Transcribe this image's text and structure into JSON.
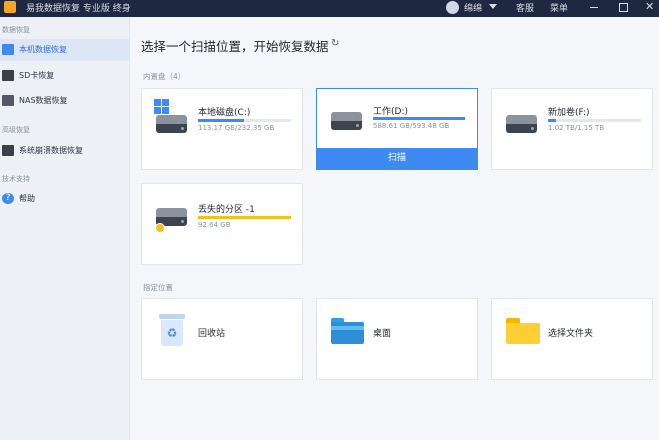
{
  "titlebar": {
    "app_title": "易我数据恢复 专业版 终身",
    "user_name": "绵绵",
    "service_label": "客服",
    "menu_label": "菜单",
    "close_glyph": "✕"
  },
  "sidebar": {
    "sections": [
      {
        "title": "数据恢复",
        "items": [
          {
            "label": "本机数据恢复",
            "icon": "monitor-icon",
            "active": true
          },
          {
            "label": "SD卡恢复",
            "icon": "sd-card-icon"
          },
          {
            "label": "NAS数据恢复",
            "icon": "nas-icon"
          }
        ]
      },
      {
        "title": "高级恢复",
        "items": [
          {
            "label": "系统崩溃数据恢复",
            "icon": "system-crash-icon"
          }
        ]
      },
      {
        "title": "技术支持",
        "items": [
          {
            "label": "帮助",
            "icon": "help-icon",
            "glyph": "?"
          }
        ]
      }
    ]
  },
  "main": {
    "title": "选择一个扫描位置，开始恢复数据",
    "refresh_glyph": "↻",
    "internal_disks": {
      "label": "内置盘（4）",
      "drives": [
        {
          "name": "本地磁盘(C:)",
          "size": "113.17 GB/232.35 GB",
          "used_fraction": 0.49,
          "icon": "windows-drive-icon"
        },
        {
          "name": "工作(D:)",
          "size": "588.61 GB/593.48 GB",
          "used_fraction": 0.99,
          "icon": "hard-drive-icon",
          "selected": true,
          "scan_label": "扫描"
        },
        {
          "name": "新加卷(F:)",
          "size": "1.02 TB/1.15 TB",
          "used_fraction": 0.09,
          "icon": "hard-drive-icon"
        },
        {
          "name": "丢失的分区 -1",
          "size": "92.64 GB",
          "used_fraction": 1.0,
          "icon": "lost-partition-icon",
          "bar_color": "#f2c11c"
        }
      ]
    },
    "specified_locations": {
      "label": "指定位置",
      "items": [
        {
          "label": "回收站",
          "icon": "recycle-bin-icon",
          "glyph": "♻"
        },
        {
          "label": "桌面",
          "icon": "desktop-folder-icon"
        },
        {
          "label": "选择文件夹",
          "icon": "folder-icon"
        }
      ]
    }
  },
  "colors": {
    "accent": "#3d8af0",
    "titlebar": "#1e2840",
    "warning": "#f2c11c"
  }
}
